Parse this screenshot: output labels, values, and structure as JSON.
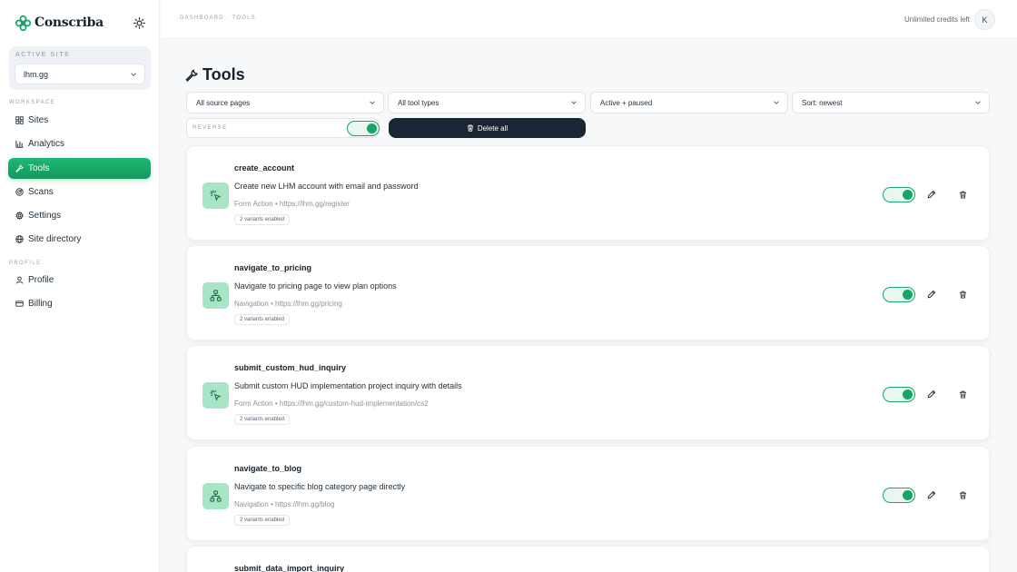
{
  "brand": {
    "name": "Conscriba",
    "accent": "#16a566"
  },
  "sidebar": {
    "active_site_label": "ACTIVE SITE",
    "active_site_value": "lhm.gg",
    "workspace_label": "WORKSPACE",
    "profile_label": "PROFILE",
    "nav": {
      "sites": "Sites",
      "analytics": "Analytics",
      "tools": "Tools",
      "scans": "Scans",
      "settings": "Settings",
      "site_directory": "Site directory",
      "profile": "Profile",
      "billing": "Billing"
    }
  },
  "topbar": {
    "breadcrumb": "DASHBOARD · TOOLS",
    "credits": "Unlimited credits left",
    "avatar_initial": "K"
  },
  "page": {
    "title": "Tools",
    "filters": {
      "source_pages": "All source pages",
      "tool_types": "All tool types",
      "status": "Active + paused",
      "sort": "Sort: newest"
    },
    "reverse_label": "REVERSE",
    "delete_all": "Delete all"
  },
  "tools": [
    {
      "name": "create_account",
      "description": "Create new LHM account with email and password",
      "meta": "Form Action • https://lhm.gg/register",
      "badge": "2 variants enabled",
      "icon": "cursor-click-icon"
    },
    {
      "name": "navigate_to_pricing",
      "description": "Navigate to pricing page to view plan options",
      "meta": "Navigation • https://lhm.gg/pricing",
      "badge": "2 variants enabled",
      "icon": "sitemap-icon"
    },
    {
      "name": "submit_custom_hud_inquiry",
      "description": "Submit custom HUD implementation project inquiry with details",
      "meta": "Form Action • https://lhm.gg/custom-hud-implementation/cs2",
      "badge": "2 variants enabled",
      "icon": "cursor-click-icon"
    },
    {
      "name": "navigate_to_blog",
      "description": "Navigate to specific blog category page directly",
      "meta": "Navigation • https://lhm.gg/blog",
      "badge": "2 variants enabled",
      "icon": "sitemap-icon"
    },
    {
      "name": "submit_data_import_inquiry"
    }
  ]
}
